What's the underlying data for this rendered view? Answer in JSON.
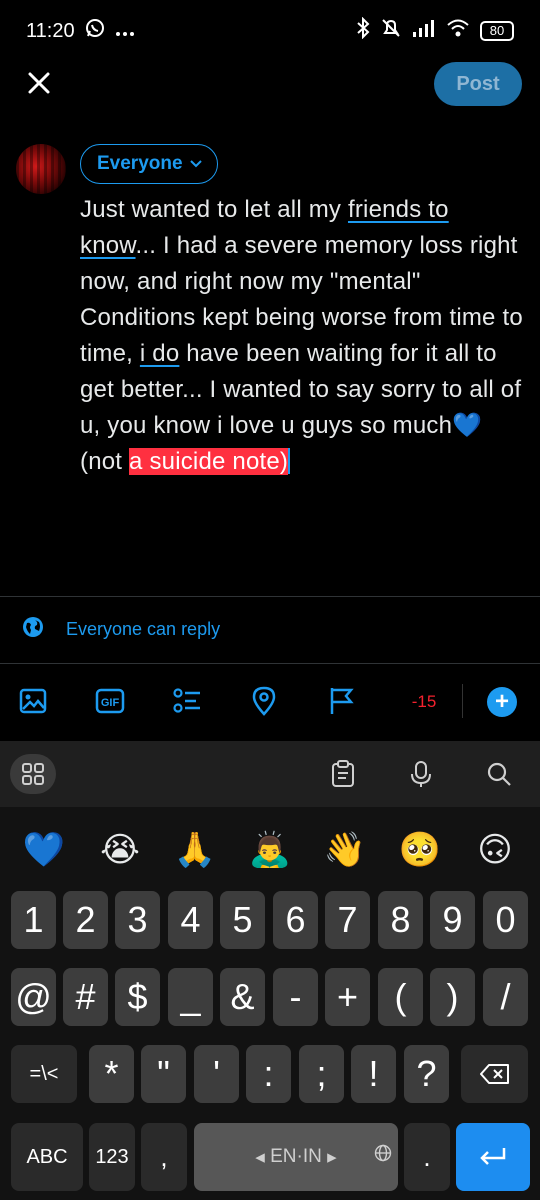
{
  "status_bar": {
    "time": "11:20",
    "battery": "80"
  },
  "header": {
    "post_label": "Post"
  },
  "compose": {
    "audience_label": "Everyone",
    "text_parts": {
      "p1": "Just wanted to let all my ",
      "link1": "friends to know",
      "p2": "... I had a severe memory loss right now, and right now my \"mental\" Conditions kept being worse from time to time, ",
      "link2": "i do",
      "p3": " have been waiting for it all to get better... I wanted to say sorry to all of u, you know i love u guys so much💙 (not ",
      "selected": "a suicide note)"
    }
  },
  "reply_setting": {
    "label": "Everyone can reply"
  },
  "toolbar": {
    "gif_label": "GIF",
    "char_counter": "-15",
    "add_label": "+"
  },
  "keyboard": {
    "emojis": [
      "💙",
      "😭",
      "🙏",
      "🙇‍♂️",
      "👋",
      "🥺",
      "🙃"
    ],
    "row1": [
      "1",
      "2",
      "3",
      "4",
      "5",
      "6",
      "7",
      "8",
      "9",
      "0"
    ],
    "row2": [
      "@",
      "#",
      "$",
      "_",
      "&",
      "-",
      "+",
      "(",
      ")",
      "/"
    ],
    "row3": [
      "=\\<",
      "*",
      "\"",
      "'",
      ":",
      ";",
      "!",
      "?"
    ],
    "row4": {
      "abc": "ABC",
      "num": "123",
      "comma": ",",
      "space_lang": "EN·IN",
      "period": "."
    }
  },
  "colors": {
    "accent": "#1d9bf0",
    "post_button": "#1d6fa5",
    "counter_negative": "#f4212e",
    "selection": "#ff3040"
  }
}
